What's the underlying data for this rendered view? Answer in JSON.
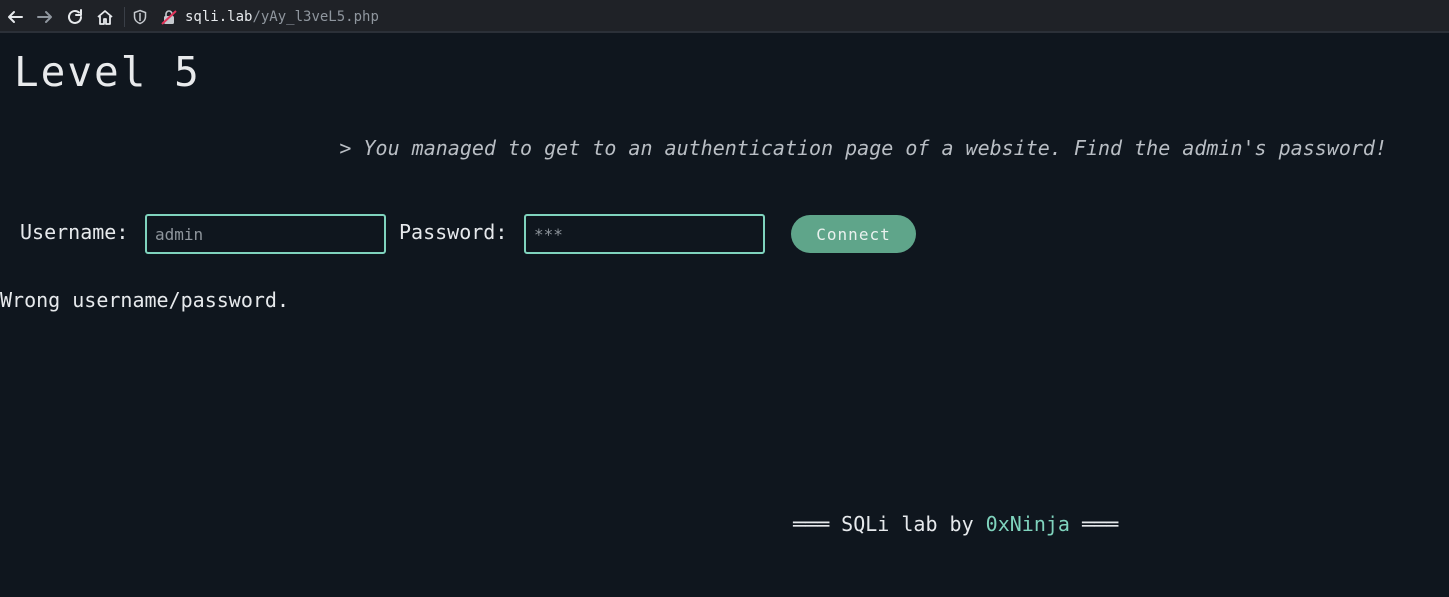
{
  "browser": {
    "back_icon": "arrow-left-icon",
    "forward_icon": "arrow-right-icon",
    "reload_icon": "reload-icon",
    "home_icon": "home-icon",
    "url_domain": "sqli.lab",
    "url_path": "/yAy_l3veL5.php"
  },
  "page": {
    "title": "Level 5",
    "description": "> You managed to get to an authentication page of a website. Find the admin's password!"
  },
  "form": {
    "username_label": "Username:",
    "username_value": "admin",
    "password_label": "Password:",
    "password_value": "***",
    "connect_label": "Connect"
  },
  "status": {
    "message": "Wrong username/password."
  },
  "footer": {
    "prefix": "═══ SQLi lab by ",
    "author": "0xNinja",
    "suffix": " ═══"
  },
  "colors": {
    "background": "#0f161e",
    "accent": "#7fd3bd",
    "button": "#5fa58a"
  }
}
